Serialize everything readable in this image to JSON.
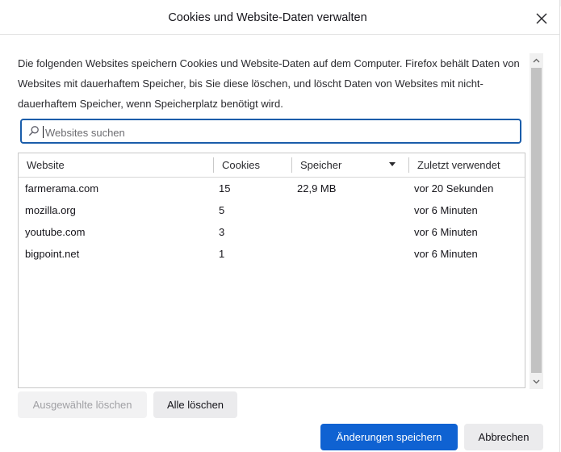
{
  "dialog": {
    "title": "Cookies und Website-Daten verwalten",
    "description": "Die folgenden Websites speichern Cookies und Website-Daten auf dem Computer. Firefox behält Daten von Websites mit dauerhaftem Speicher, bis Sie diese löschen, und löscht Daten von Websites mit nicht-dauerhaftem Speicher, wenn Speicherplatz benötigt wird."
  },
  "search": {
    "placeholder": "Websites suchen",
    "value": ""
  },
  "table": {
    "columns": {
      "website": "Website",
      "cookies": "Cookies",
      "storage": "Speicher",
      "last_used": "Zuletzt verwendet"
    },
    "sorted_column": "storage",
    "sort_direction": "descending",
    "rows": [
      {
        "site": "farmerama.com",
        "cookies": "15",
        "storage": "22,9 MB",
        "last_used": "vor 20 Sekunden"
      },
      {
        "site": "mozilla.org",
        "cookies": "5",
        "storage": "",
        "last_used": "vor 6 Minuten"
      },
      {
        "site": "youtube.com",
        "cookies": "3",
        "storage": "",
        "last_used": "vor 6 Minuten"
      },
      {
        "site": "bigpoint.net",
        "cookies": "1",
        "storage": "",
        "last_used": "vor 6 Minuten"
      }
    ]
  },
  "buttons": {
    "remove_selected": "Ausgewählte löschen",
    "remove_all": "Alle löschen",
    "save_changes": "Änderungen speichern",
    "cancel": "Abbrechen"
  },
  "icons": {
    "close": "close-icon",
    "search": "search-icon",
    "sort": "sort-descending-icon",
    "scroll_up": "chevron-up-icon",
    "scroll_down": "chevron-down-icon"
  },
  "colors": {
    "accent": "#0f62d2",
    "search_focus_border": "#1a5daa"
  }
}
